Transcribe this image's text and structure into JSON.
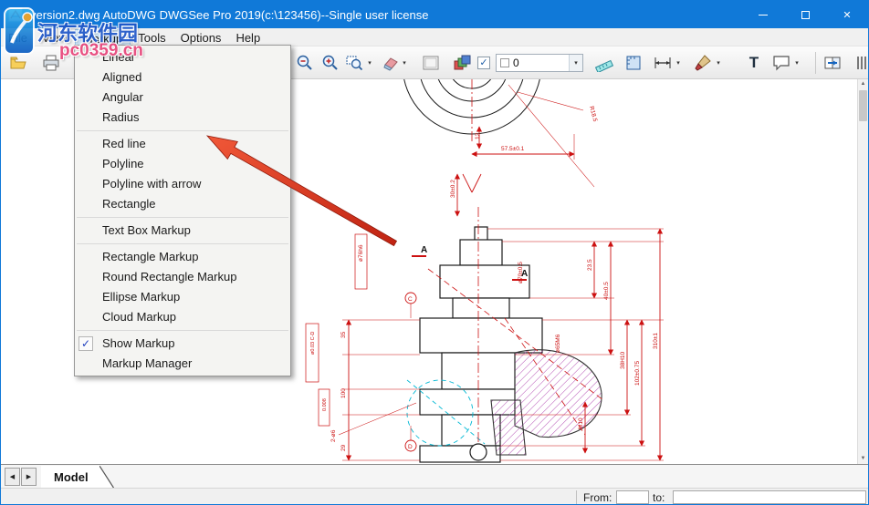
{
  "window": {
    "title": "version2.dwg AutoDWG DWGSee Pro 2019(c:\\123456)--Single user license"
  },
  "icons": {
    "close": "✕",
    "check": "✓",
    "dropdown": "▾",
    "tab_prev": "◀",
    "tab_next": "▶",
    "scroll_up": "▲",
    "scroll_down": "▼"
  },
  "menubar": {
    "items": [
      "File",
      "View",
      "Markup",
      "Tools",
      "Options",
      "Help"
    ]
  },
  "markup_menu": {
    "dimension_items": [
      "Linear",
      "Aligned",
      "Angular",
      "Radius"
    ],
    "line_items": [
      "Red line",
      "Polyline",
      "Polyline with arrow",
      "Rectangle"
    ],
    "text_items": [
      "Text Box Markup"
    ],
    "shape_items": [
      "Rectangle Markup",
      "Round Rectangle Markup",
      "Ellipse Markup",
      "Cloud Markup"
    ],
    "toggle_items": [
      "Show Markup",
      "Markup Manager"
    ],
    "show_markup_checked": true
  },
  "toolbar": {
    "layer_value": "0",
    "text_tool": "T"
  },
  "tabbar": {
    "model_tab": "Model"
  },
  "statusbar": {
    "from_label": "From:",
    "to_label": "to:"
  },
  "watermark": {
    "line1": "河东软件园",
    "line2": "pc0359.cn"
  },
  "colors": {
    "titlebar_blue": "#1079d8",
    "annotation_red": "#d43318",
    "dimension_red": "#cc1111",
    "hatch_magenta": "#b24bb2",
    "centerline_cyan": "#00b8d4"
  },
  "drawing": {
    "labels": [
      "57.5±0.1",
      "12",
      "30±0.2",
      "R18.5",
      "ø76h6",
      "ø70±0.5",
      "ø65M6",
      "23.5",
      "40±0.5",
      "38H10",
      "102±0.75",
      "310±1",
      "M10",
      "35",
      "100",
      "29",
      "2-ø6",
      "ø0.03 C-D",
      "0.008",
      "A",
      "A",
      "C",
      "D"
    ]
  }
}
